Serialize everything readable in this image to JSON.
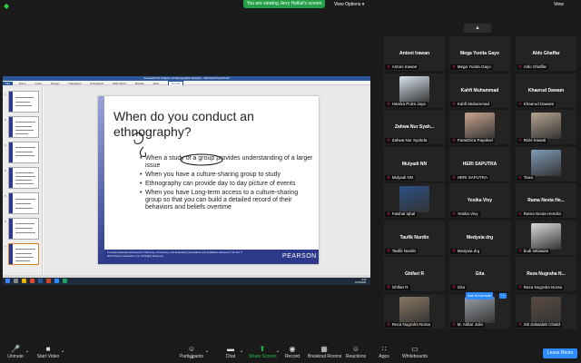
{
  "top_bar": {
    "viewing_text": "You are viewing Jerry Helkal's screen",
    "view_options": "View Options ▾",
    "view_label": "View"
  },
  "ppt": {
    "title": "Creswell 5TH Chapter 14 Ethnographic Designs - Microsoft PowerPoint",
    "ribbon_tabs": [
      "File",
      "Home",
      "Insert",
      "Design",
      "Transitions",
      "Animations",
      "Slide Show",
      "Review",
      "View",
      "Format"
    ],
    "clock_time": "9:05",
    "clock_date": "19/10/2021"
  },
  "slide": {
    "title": "When do you conduct an ethnography?",
    "bullets": [
      "When a study of a group provides understanding of a larger issue",
      "When you have a culture-sharing group to study",
      "Ethnography can provide day to day picture of events",
      "When you have Long-term access to a culture-sharing group so that you can build a detailed record of their behaviors and beliefs overtime"
    ],
    "footer_citation": "Creswell, Educational Research: Planning, Conducting, and Evaluating Quantitative and Qualitative Research, 5th Ed. © 2015 Pearson Education, Inc. All Rights Reserved.",
    "brand": "PEARSON"
  },
  "participants": [
    {
      "display": "Antoni Irawan",
      "label": "Antoni Irawan",
      "video": false
    },
    {
      "display": "Mega Yunita Gayo",
      "label": "Mega Yunita Gayo",
      "video": false
    },
    {
      "display": "Aldo Ghaffar",
      "label": "Aldo Ghaffar",
      "video": false
    },
    {
      "display": "",
      "label": "Hamka Putra Jaya",
      "video": true,
      "video_color": "#d7e3ee"
    },
    {
      "display": "Kahfi Muhammad",
      "label": "Kahfi Muhammad",
      "video": false
    },
    {
      "display": "Khaerud Dawam",
      "label": "Khaerud Dawam",
      "video": false
    },
    {
      "display": "Zahwa Nur Syah...",
      "label": "Zahwa Nur Syahda",
      "video": false
    },
    {
      "display": "",
      "label": "FarasDica Payakuri",
      "video": true,
      "video_color": "#c9a48d"
    },
    {
      "display": "",
      "label": "Rizki Irawati",
      "video": true,
      "video_color": "#b6a491"
    },
    {
      "display": "Mulyadi NN",
      "label": "Mulyadi NN",
      "video": false
    },
    {
      "display": "HERI SAPUTRA",
      "label": "HERI SAPUTRA",
      "video": false
    },
    {
      "display": "",
      "label": "Tiara",
      "video": true,
      "video_color": "#7e9bb8"
    },
    {
      "display": "",
      "label": "Faishal Iqbal",
      "video": true,
      "video_color": "#2a4f86"
    },
    {
      "display": "Yesika Vivy",
      "label": "Yesika Vivy",
      "video": false
    },
    {
      "display": "Rama Nevta He...",
      "label": "Rama Nevta Hendra",
      "video": false
    },
    {
      "display": "Taufik Nurdin",
      "label": "Taufik Nurdin",
      "video": false
    },
    {
      "display": "Medysia drg",
      "label": "Medysia drg",
      "video": false
    },
    {
      "display": "",
      "label": "budi setiawan",
      "video": true,
      "video_color": "#dcdcdc"
    },
    {
      "display": "Ghifari R",
      "label": "Ghifari R",
      "video": false
    },
    {
      "display": "Gita",
      "label": "Gita",
      "video": false
    },
    {
      "display": "Reza Nugraha N...",
      "label": "Reza Nugraha Norsa",
      "video": false
    },
    {
      "display": "",
      "label": "Reza Nugraha Norsa",
      "video": true,
      "video_color": "#8a7862"
    },
    {
      "display": "",
      "label": "M. Akbar Julio",
      "video": true,
      "video_color": "#9aa0a8"
    },
    {
      "display": "",
      "label": "Siti Zubaidah Chalid",
      "video": true,
      "video_color": "#5a4b41"
    }
  ],
  "ask_to_unmute": "Ask to Unmute",
  "toolbar": {
    "unmute": "Unmute",
    "start_video": "Start Video",
    "participants": "Participants",
    "participants_count": "55",
    "chat": "Chat",
    "share_screen": "Share Screen",
    "record": "Record",
    "breakout": "Breakout Rooms",
    "reactions": "Reactions",
    "apps": "Apps",
    "whiteboards": "Whiteboards",
    "leave": "Leave Room"
  },
  "colors": {
    "accent_blue": "#2d8cff",
    "share_green": "#24a148",
    "mute_red": "#e02828",
    "slide_navy": "#2d3a8c"
  }
}
